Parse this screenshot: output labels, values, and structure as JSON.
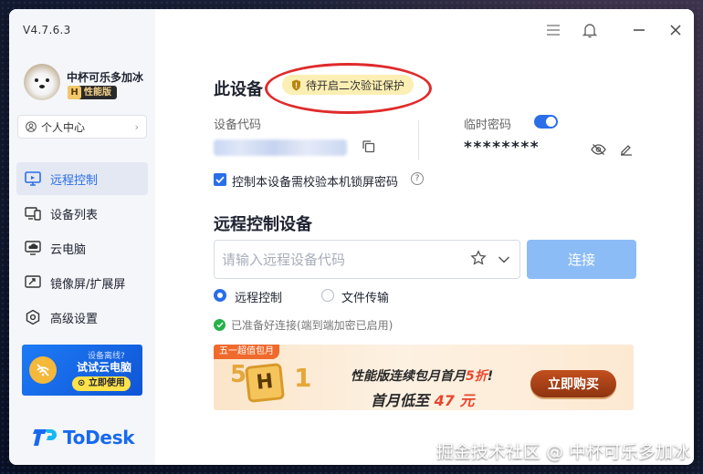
{
  "app": {
    "version": "V4.7.6.3",
    "brand": "ToDesk",
    "accent": "#2a6ee8"
  },
  "user": {
    "name": "中杯可乐多加冰",
    "badge_letter": "H",
    "badge_text": "性能版",
    "personal_center": "个人中心"
  },
  "sidebar": {
    "items": [
      {
        "label": "远程控制",
        "icon": "monitor-remote-icon",
        "active": true
      },
      {
        "label": "设备列表",
        "icon": "devices-icon",
        "active": false
      },
      {
        "label": "云电脑",
        "icon": "cloud-pc-icon",
        "active": false
      },
      {
        "label": "镜像屏/扩展屏",
        "icon": "mirror-screen-icon",
        "active": false
      },
      {
        "label": "高级设置",
        "icon": "settings-icon",
        "active": false
      }
    ],
    "promo": {
      "question": "设备离线?",
      "title": "试试云电脑",
      "button": "立即使用"
    }
  },
  "device": {
    "title": "此设备",
    "verify_label": "待开启二次验证保护",
    "code_label": "设备代码",
    "temp_password_label": "临时密码",
    "temp_password_enabled": true,
    "password_masked": "********",
    "lock_check_label": "控制本设备需校验本机锁屏密码",
    "lock_check_checked": true
  },
  "remote": {
    "title": "远程控制设备",
    "input_placeholder": "请输入远程设备代码",
    "connect_label": "连接",
    "modes": [
      {
        "label": "远程控制",
        "selected": true
      },
      {
        "label": "文件传输",
        "selected": false
      }
    ],
    "status": "已准备好连接(端到端加密已启用)"
  },
  "banner": {
    "tag": "五一超值包月",
    "line1_prefix": "性能版连续包月首月",
    "line1_highlight": "5折",
    "line1_suffix": "!",
    "line2_prefix": "首月低至",
    "line2_highlight": "47",
    "line2_suffix": "元",
    "buy_label": "立即购买"
  },
  "watermark": "掘金技术社区 @ 中杯可乐多加冰"
}
